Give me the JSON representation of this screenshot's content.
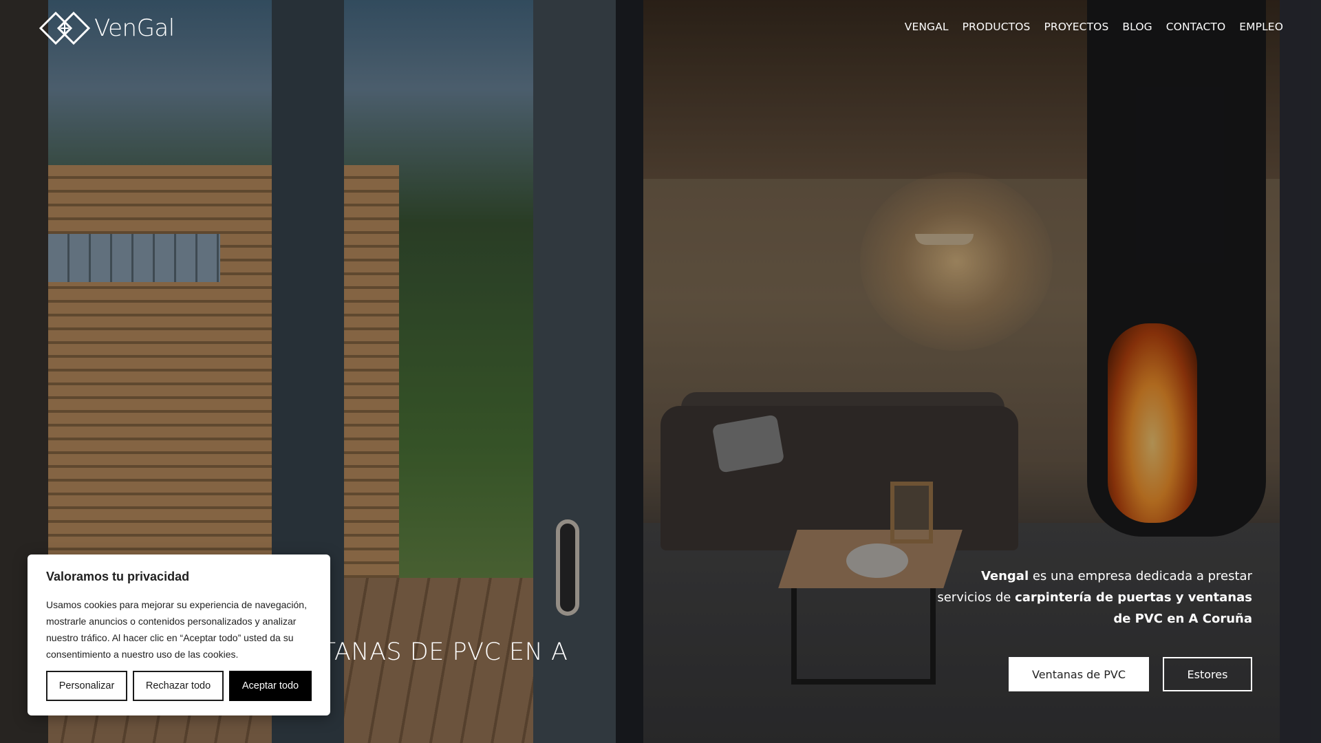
{
  "brand": {
    "name": "VenGal",
    "logo_icon": "diamond-logo-icon"
  },
  "nav": {
    "items": [
      {
        "label": "VENGAL"
      },
      {
        "label": "PRODUCTOS"
      },
      {
        "label": "PROYECTOS"
      },
      {
        "label": "BLOG"
      },
      {
        "label": "CONTACTO"
      },
      {
        "label": "EMPLEO"
      }
    ]
  },
  "hero": {
    "title_visible": "NTANAS DE PVC EN A",
    "description": {
      "part1_bold": "Vengal",
      "part2": " es una empresa dedicada a prestar servicios de ",
      "part3_bold": "carpintería de puertas y ventanas de PVC en A Coruña"
    },
    "buttons": {
      "primary": "Ventanas de PVC",
      "secondary": "Estores"
    }
  },
  "cookie_banner": {
    "title": "Valoramos tu privacidad",
    "text": "Usamos cookies para mejorar su experiencia de navegación, mostrarle anuncios o contenidos personalizados y analizar nuestro tráfico. Al hacer clic en “Aceptar todo” usted da su consentimiento a nuestro uso de las cookies.",
    "buttons": {
      "customize": "Personalizar",
      "reject": "Rechazar todo",
      "accept": "Aceptar todo"
    }
  },
  "colors": {
    "accent_dark": "#000000",
    "text_light": "#ffffff"
  }
}
